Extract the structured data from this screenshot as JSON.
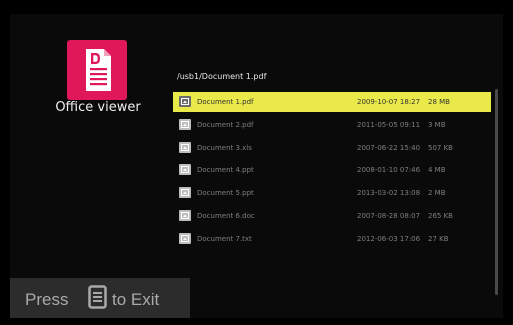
{
  "app": {
    "title": "Office viewer",
    "icon": "document-icon",
    "accent_color": "#e0185a"
  },
  "path": "/usb1/Document 1.pdf",
  "files": [
    {
      "name": "Document 1.pdf",
      "date": "2009-10-07 18:27",
      "size": "28 MB",
      "selected": true
    },
    {
      "name": "Document 2.pdf",
      "date": "2011-05-05 09:11",
      "size": "3 MB"
    },
    {
      "name": "Document 3.xls",
      "date": "2007-06-22 15:40",
      "size": "507 KB"
    },
    {
      "name": "Document 4.ppt",
      "date": "2008-01-10 07:46",
      "size": "4 MB"
    },
    {
      "name": "Document 5.ppt",
      "date": "2013-03-02 13:08",
      "size": "2 MB"
    },
    {
      "name": "Document 6.doc",
      "date": "2007-08-28 08:07",
      "size": "265 KB"
    },
    {
      "name": "Document 7.txt",
      "date": "2012-06-03 17:06",
      "size": "27 KB"
    }
  ],
  "selection_color": "#e9e94a",
  "exit_hint": {
    "press": "Press",
    "key_icon": "menu-key-icon",
    "to_exit": "to Exit"
  }
}
